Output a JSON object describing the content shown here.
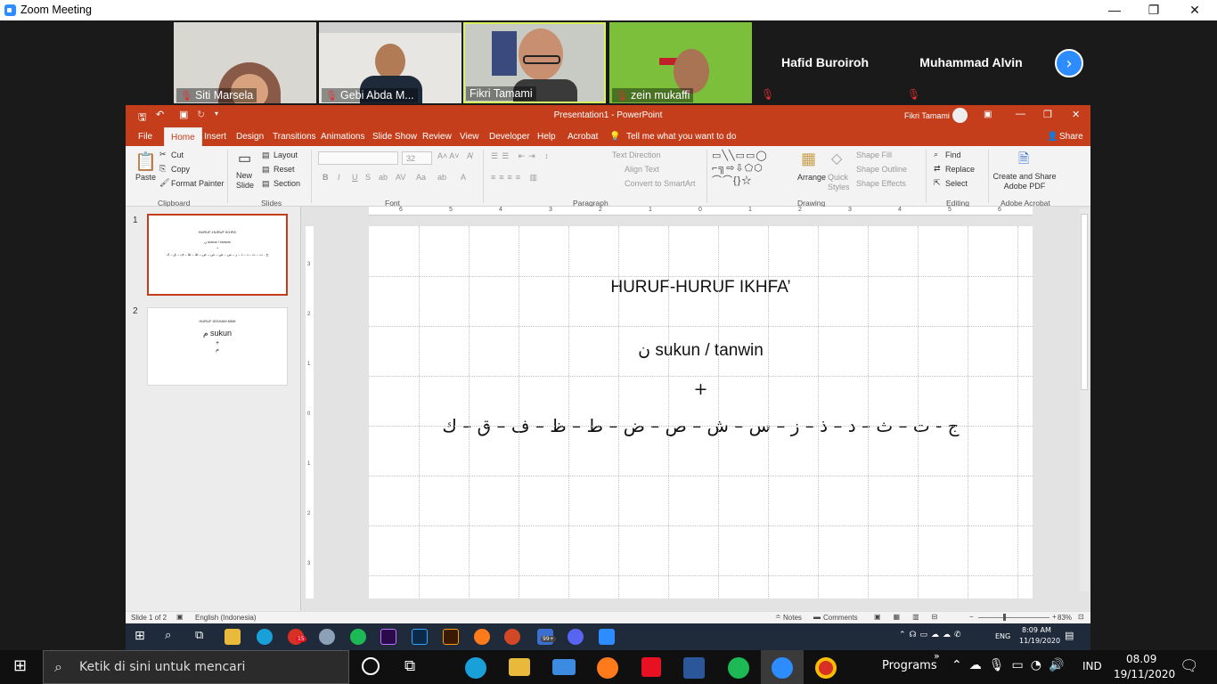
{
  "zoom": {
    "title": "Zoom Meeting"
  },
  "participants": [
    {
      "name": "Siti Marsela"
    },
    {
      "name": "Gebi Abda M..."
    },
    {
      "name": "Fikri Tamami"
    },
    {
      "name": "zein mukaffi"
    },
    {
      "name": "Hafid Buroiroh"
    },
    {
      "name": "Muhammad Alvin"
    }
  ],
  "ppt": {
    "title": "Presentation1  -  PowerPoint",
    "user": "Fikri Tamami",
    "tabs": [
      "File",
      "Home",
      "Insert",
      "Design",
      "Transitions",
      "Animations",
      "Slide Show",
      "Review",
      "View",
      "Developer",
      "Help",
      "Acrobat"
    ],
    "tellme": "Tell me what you want to do",
    "share": "Share",
    "ribbon": {
      "paste": "Paste",
      "cut": "Cut",
      "copy": "Copy",
      "format_painter": "Format Painter",
      "clipboard": "Clipboard",
      "new_slide": "New Slide",
      "layout": "Layout",
      "reset": "Reset",
      "section": "Section",
      "slides": "Slides",
      "font_size": "32",
      "font": "Font",
      "paragraph": "Paragraph",
      "text_direction": "Text Direction",
      "align_text": "Align Text",
      "convert": "Convert to SmartArt",
      "arrange": "Arrange",
      "quick_styles": "Quick Styles",
      "shape_fill": "Shape Fill",
      "shape_outline": "Shape Outline",
      "shape_effects": "Shape Effects",
      "drawing": "Drawing",
      "find": "Find",
      "replace": "Replace",
      "select": "Select",
      "editing": "Editing",
      "create_share": "Create and Share Adobe PDF",
      "adobe": "Adobe Acrobat"
    },
    "thumbs": [
      {
        "num": "1",
        "title": "HURUF-HURUF IKHFA'",
        "line2": "ن sukun / tanwin",
        "line3": "+",
        "line4": "ج - ت – ث – د – ذ – ز – س – ش – ص – ض – ط – ظ – ف – ق – ك"
      },
      {
        "num": "2",
        "title": "HURUF IDGHAM MIMI",
        "line2": "م sukun",
        "line3": "+",
        "line4": "م"
      }
    ],
    "ruler": [
      "6",
      "5",
      "4",
      "3",
      "2",
      "1",
      "0",
      "1",
      "2",
      "3",
      "4",
      "5",
      "6"
    ],
    "vruler": [
      "3",
      "2",
      "1",
      "0",
      "1",
      "2",
      "3"
    ],
    "slide": {
      "title": "HURUF-HURUF IKHFA’",
      "line2": "ن sukun / tanwin",
      "plus": "+",
      "letters": "ج - ت – ث – د – ذ – ز – س – ش – ص – ض – ط – ظ – ف – ق – ك"
    },
    "status": {
      "slide": "Slide 1 of 2",
      "lang": "English (Indonesia)",
      "notes": "Notes",
      "comments": "Comments",
      "zoom": "83%"
    }
  },
  "inner_taskbar": {
    "lang": "ENG",
    "time": "8:09 AM",
    "date": "11/19/2020",
    "badge1": "15",
    "badge2": "99+"
  },
  "taskbar": {
    "search": "Ketik di sini untuk mencari",
    "programs": "Programs",
    "lang": "IND",
    "time": "08.09",
    "date": "19/11/2020"
  }
}
